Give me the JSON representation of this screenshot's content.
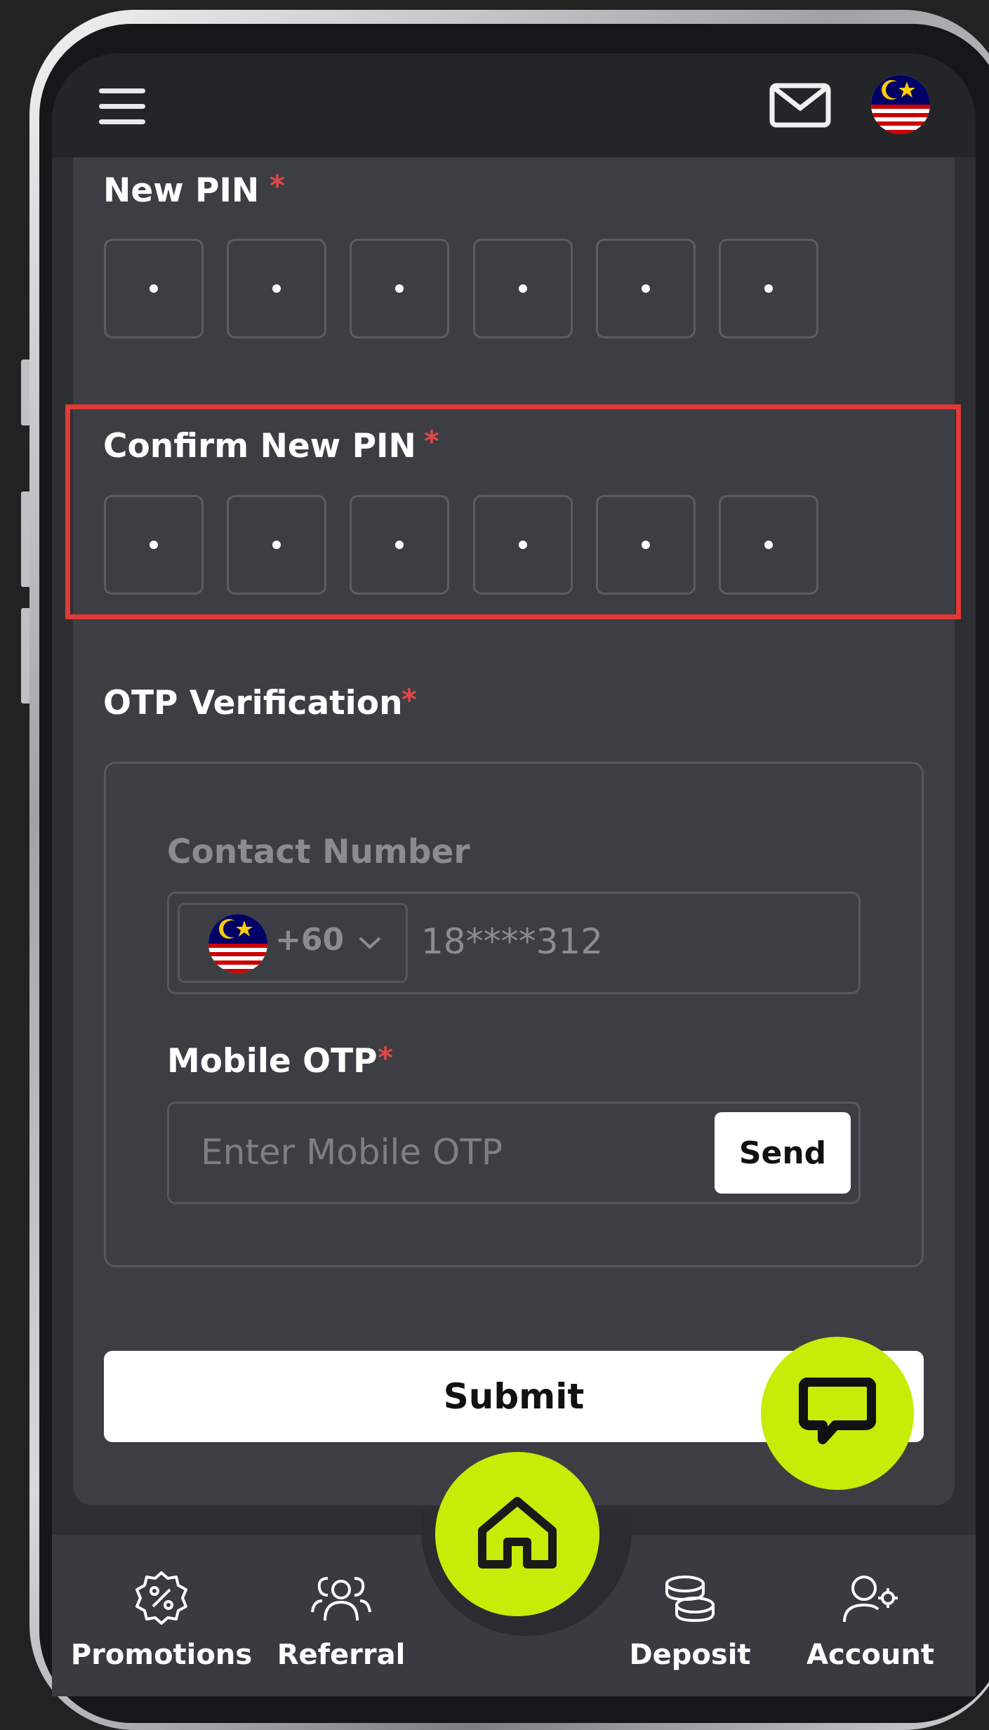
{
  "colors": {
    "accent": "#c6ec07",
    "required": "#e24747",
    "highlight": "#e03a36",
    "card": "#3d3e43"
  },
  "topbar": {
    "menu_icon": "hamburger-icon",
    "mail_icon": "mail-icon",
    "language_icon": "malaysia-flag-icon"
  },
  "form": {
    "new_pin": {
      "label": "New PIN",
      "required": "*",
      "digits": [
        "•",
        "•",
        "•",
        "•",
        "•",
        "•"
      ]
    },
    "confirm_pin": {
      "label": "Confirm New PIN",
      "required": "*",
      "digits": [
        "•",
        "•",
        "•",
        "•",
        "•",
        "•"
      ]
    },
    "otp": {
      "label": "OTP Verification",
      "required": "*",
      "contact_label": "Contact Number",
      "country_code": "+60",
      "phone_value": "18****312",
      "mobile_otp_label": "Mobile OTP",
      "mobile_otp_required": "*",
      "mobile_otp_placeholder": "Enter Mobile OTP",
      "send_label": "Send"
    },
    "submit_label": "Submit"
  },
  "bottom_nav": {
    "items": [
      {
        "label": "Promotions",
        "icon": "promotion-badge-icon"
      },
      {
        "label": "Referral",
        "icon": "referral-users-icon"
      },
      {
        "label": "",
        "icon": "home-icon"
      },
      {
        "label": "Deposit",
        "icon": "coins-icon"
      },
      {
        "label": "Account",
        "icon": "account-settings-icon"
      }
    ]
  }
}
